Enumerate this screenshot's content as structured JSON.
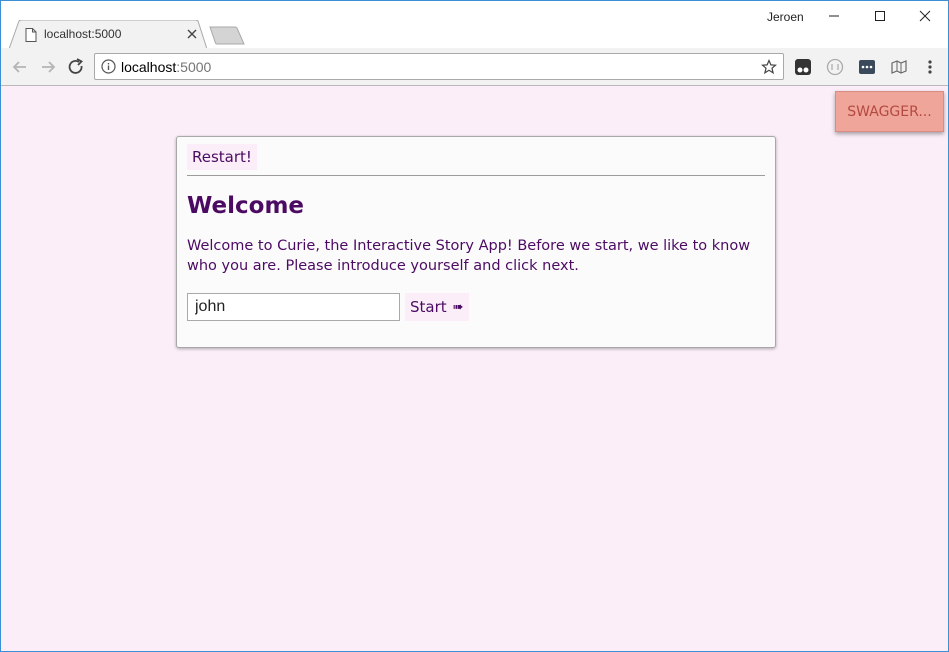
{
  "browser": {
    "tab": {
      "title": "localhost:5000"
    },
    "profile_name": "Jeroen",
    "address_bar": {
      "host": "localhost",
      "port": ":5000"
    }
  },
  "page": {
    "swagger_button_label": "SWAGGER...",
    "card": {
      "restart_label": "Restart!",
      "title": "Welcome",
      "text": "Welcome to Curie, the Interactive Story App! Before we start, we like to know who you are. Please introduce yourself and click next.",
      "name_input_value": "john",
      "start_label": "Start",
      "start_arrow": "➠"
    }
  },
  "colors": {
    "page_background": "#fbeef8",
    "text_purple": "#4c0b63",
    "swagger_bg": "#f0a59a",
    "swagger_text": "#b34a3f",
    "window_border": "#3c8fd4"
  }
}
